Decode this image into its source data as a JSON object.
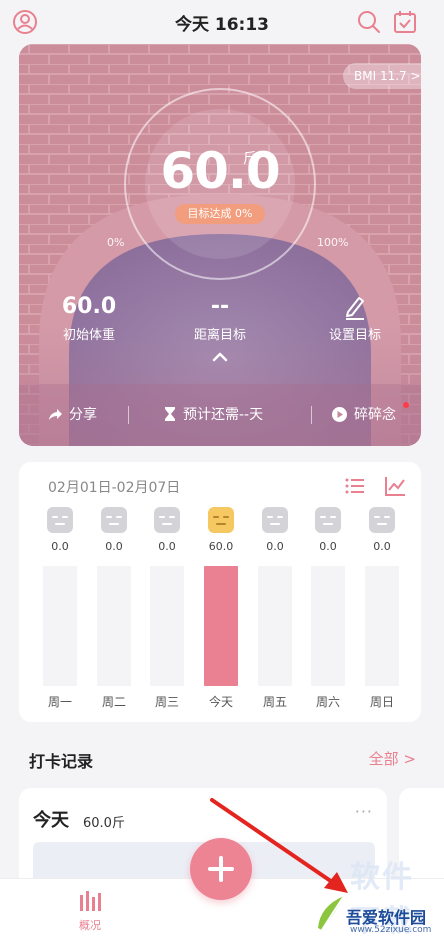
{
  "header": {
    "title": "今天 16:13",
    "left_icon": "user-circle-icon",
    "right_icons": [
      "search-icon",
      "calendar-check-icon"
    ]
  },
  "hero": {
    "bmi": "BMI 11.7 >",
    "weight": "60.0",
    "weight_unit": "斤",
    "goal_progress": "目标达成 0%",
    "pct_left": "0%",
    "pct_right": "100%",
    "stats": [
      {
        "value": "60.0",
        "label": "初始体重"
      },
      {
        "value": "--",
        "label": "距离目标"
      },
      {
        "value": "",
        "label": "设置目标",
        "icon": "pencil-icon"
      }
    ],
    "actions": [
      {
        "label": "分享",
        "icon": "share-icon"
      },
      {
        "label": "预计还需--天",
        "icon": "hourglass-icon"
      },
      {
        "label": "碎碎念",
        "icon": "play-circle-icon"
      }
    ]
  },
  "week": {
    "range": "02月01日-02月07日",
    "view_icons": [
      "list-icon",
      "line-chart-icon"
    ],
    "days": [
      {
        "label": "周一",
        "value": "0.0",
        "fill": 0,
        "today": false
      },
      {
        "label": "周二",
        "value": "0.0",
        "fill": 0,
        "today": false
      },
      {
        "label": "周三",
        "value": "0.0",
        "fill": 0,
        "today": false
      },
      {
        "label": "今天",
        "value": "60.0",
        "fill": 1,
        "today": true
      },
      {
        "label": "周五",
        "value": "0.0",
        "fill": 0,
        "today": false
      },
      {
        "label": "周六",
        "value": "0.0",
        "fill": 0,
        "today": false
      },
      {
        "label": "周日",
        "value": "0.0",
        "fill": 0,
        "today": false
      }
    ]
  },
  "checkin": {
    "title": "打卡记录",
    "more": "全部 >",
    "card": {
      "title": "今天",
      "weight": "60.0斤",
      "menu": "···"
    }
  },
  "bottomnav": {
    "overview_label": "概况",
    "add_button": "+"
  },
  "watermark": {
    "chars": "软件下载",
    "name": "吾爱软件园",
    "url": "www.52zixue.com"
  },
  "colors": {
    "accent": "#ec8494",
    "hero_bg": "#c98c98",
    "badge": "#f29d7d",
    "today_face": "#f6c862"
  }
}
